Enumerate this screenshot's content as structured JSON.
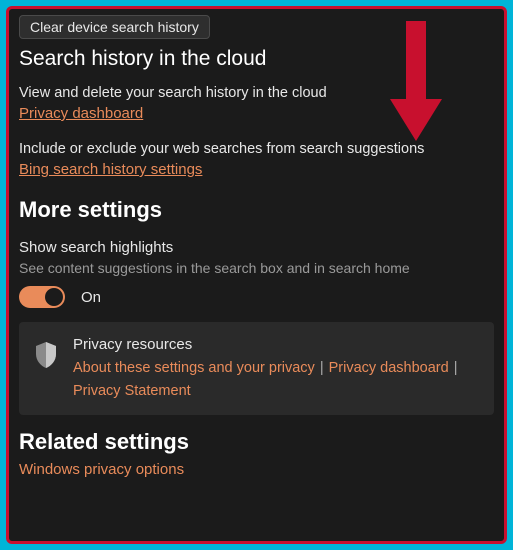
{
  "clear_button_label": "Clear device search history",
  "cloud_section_title": "Search history in the cloud",
  "cloud_view_text": "View and delete your search history in the cloud",
  "privacy_dashboard_link": "Privacy dashboard",
  "include_exclude_text": "Include or exclude your web searches from search suggestions",
  "bing_history_link": "Bing search history settings",
  "more_settings_title": "More settings",
  "highlights_label": "Show search highlights",
  "highlights_sub": "See content suggestions in the search box and in search home",
  "toggle_state": "On",
  "card": {
    "title": "Privacy resources",
    "link1": "About these settings and your privacy",
    "link2": "Privacy dashboard",
    "link3": "Privacy Statement"
  },
  "related_title": "Related settings",
  "windows_privacy_link": "Windows privacy options",
  "colors": {
    "accent": "#e98b5a",
    "frame_border": "#c8102e",
    "outer_bg": "#00b4d8"
  }
}
